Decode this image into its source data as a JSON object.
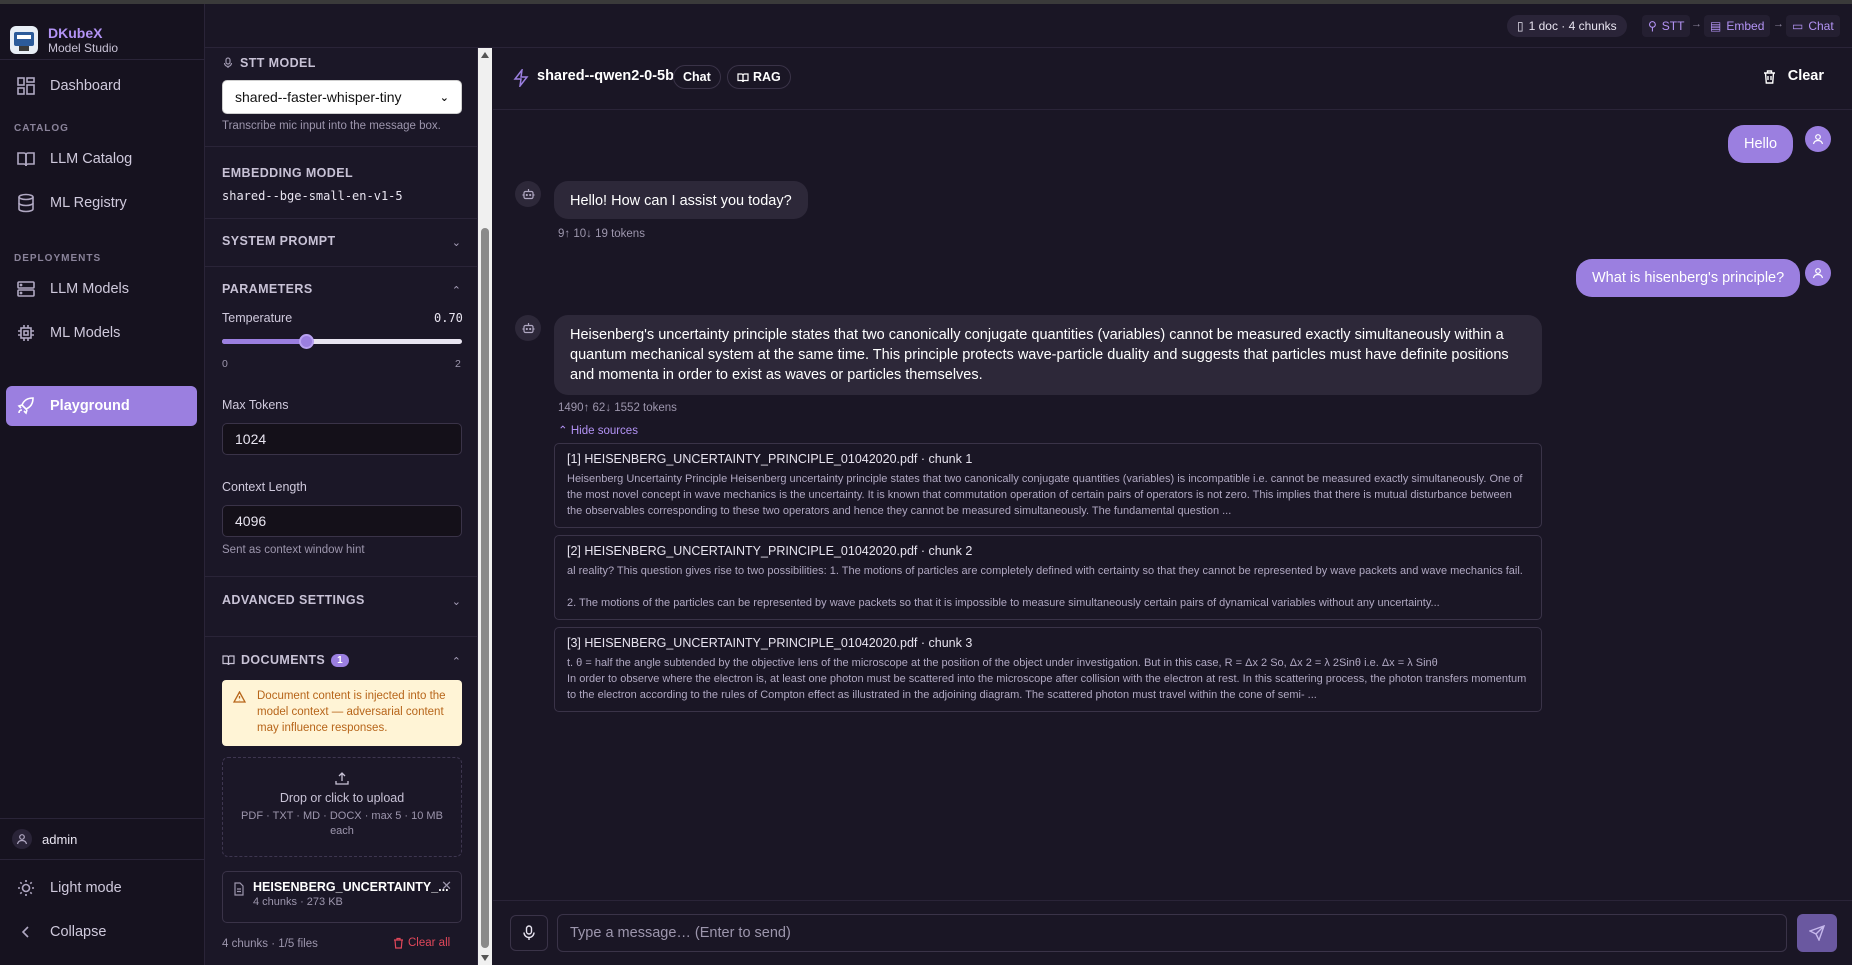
{
  "brand": {
    "name": "DKubeX",
    "subtitle": "Model Studio"
  },
  "sidebar": {
    "sections": {
      "catalog": "CATALOG",
      "deployments": "DEPLOYMENTS"
    },
    "items": [
      {
        "label": "Dashboard",
        "icon": "grid-icon"
      },
      {
        "label": "LLM Catalog",
        "icon": "book-icon"
      },
      {
        "label": "ML Registry",
        "icon": "database-icon"
      },
      {
        "label": "LLM Models",
        "icon": "server-icon"
      },
      {
        "label": "ML Models",
        "icon": "cpu-icon"
      },
      {
        "label": "Playground",
        "icon": "rocket-icon",
        "active": true
      }
    ],
    "user": "admin",
    "light_mode": "Light mode",
    "collapse": "Collapse"
  },
  "topbar": {
    "docs_pill": "1 doc · 4 chunks",
    "stt": "STT",
    "embed": "Embed",
    "chat": "Chat"
  },
  "settings": {
    "stt": {
      "title": "STT MODEL",
      "value": "shared--faster-whisper-tiny",
      "hint": "Transcribe mic input into the message box."
    },
    "embedding": {
      "title": "EMBEDDING MODEL",
      "value": "shared--bge-small-en-v1-5"
    },
    "system_prompt": {
      "title": "SYSTEM PROMPT"
    },
    "parameters": {
      "title": "PARAMETERS",
      "temperature_label": "Temperature",
      "temperature_value": "0.70",
      "temperature_fraction": 0.35,
      "min": "0",
      "max": "2",
      "max_tokens_label": "Max Tokens",
      "max_tokens": "1024",
      "context_label": "Context Length",
      "context": "4096",
      "context_hint": "Sent as context window hint"
    },
    "advanced": {
      "title": "ADVANCED SETTINGS"
    },
    "documents": {
      "title": "DOCUMENTS",
      "count": "1",
      "warning": "Document content is injected into the model context — adversarial content may influence responses.",
      "drop_title": "Drop or click to upload",
      "drop_hint": "PDF · TXT · MD · DOCX · max 5 · 10 MB each",
      "file_name": "HEISENBERG_UNCERTAINTY_...",
      "file_meta": "4 chunks · 273 KB",
      "footer": "4 chunks · 1/5 files",
      "clear_all": "Clear all"
    }
  },
  "chat": {
    "model": "shared--qwen2-0-5b",
    "tag_chat": "Chat",
    "tag_rag": "RAG",
    "clear": "Clear",
    "messages": {
      "u1": "Hello",
      "b1": "Hello! How can I assist you today?",
      "b1_meta": "9↑ 10↓ 19 tokens",
      "u2": "What is hisenberg's principle?",
      "b2": "Heisenberg's uncertainty principle states that two canonically conjugate quantities (variables) cannot be measured exactly simultaneously within a quantum mechanical system at the same time. This principle protects wave-particle duality and suggests that particles must have definite positions and momenta in order to exist as waves or particles themselves.",
      "b2_meta": "1490↑ 62↓ 1552 tokens"
    },
    "hide_sources": "Hide sources",
    "sources": [
      {
        "title": "[1] HEISENBERG_UNCERTAINTY_PRINCIPLE_01042020.pdf · chunk 1",
        "text": "Heisenberg Uncertainty Principle Heisenberg uncertainty principle states that two canonically conjugate quantities (variables) is incompatible i.e. cannot be measured exactly simultaneously. One of the most novel concept in wave mechanics is the uncertainty. It is known that commutation operation of certain pairs of operators is not zero. This implies that there is mutual disturbance between the observables corresponding to these two operators and hence they cannot be measured simultaneously. The fundamental question ..."
      },
      {
        "title": "[2] HEISENBERG_UNCERTAINTY_PRINCIPLE_01042020.pdf · chunk 2",
        "text": "al reality? This question gives rise to two possibilities: 1. The motions of particles are completely defined with certainty so that they cannot be represented by wave packets and wave mechanics fail.",
        "text2": "2. The motions of the particles can be represented by wave packets so that it is impossible to measure simultaneously certain pairs of dynamical variables without any uncertainty..."
      },
      {
        "title": "[3] HEISENBERG_UNCERTAINTY_PRINCIPLE_01042020.pdf · chunk 3",
        "text": "t. θ = half the angle subtended by the objective lens of the microscope at the position of the object under investigation. But in this case, R = Δx 2 So, Δx 2 = λ 2Sinθ i.e. Δx = λ Sinθ",
        "text2": "In order to observe where the electron is, at least one photon must be scattered into the microscope after collision with the electron at rest. In this scattering process, the photon transfers momentum to the electron according to the rules of Compton effect as illustrated in the adjoining diagram. The scattered photon must travel within the cone of semi- ..."
      }
    ],
    "input_placeholder": "Type a message… (Enter to send)"
  },
  "colors": {
    "accent": "#9b7fe0",
    "bg": "#1a1625",
    "bubble_bot": "#2d2839",
    "warn_bg": "#fff4d6",
    "danger": "#e0475a"
  }
}
